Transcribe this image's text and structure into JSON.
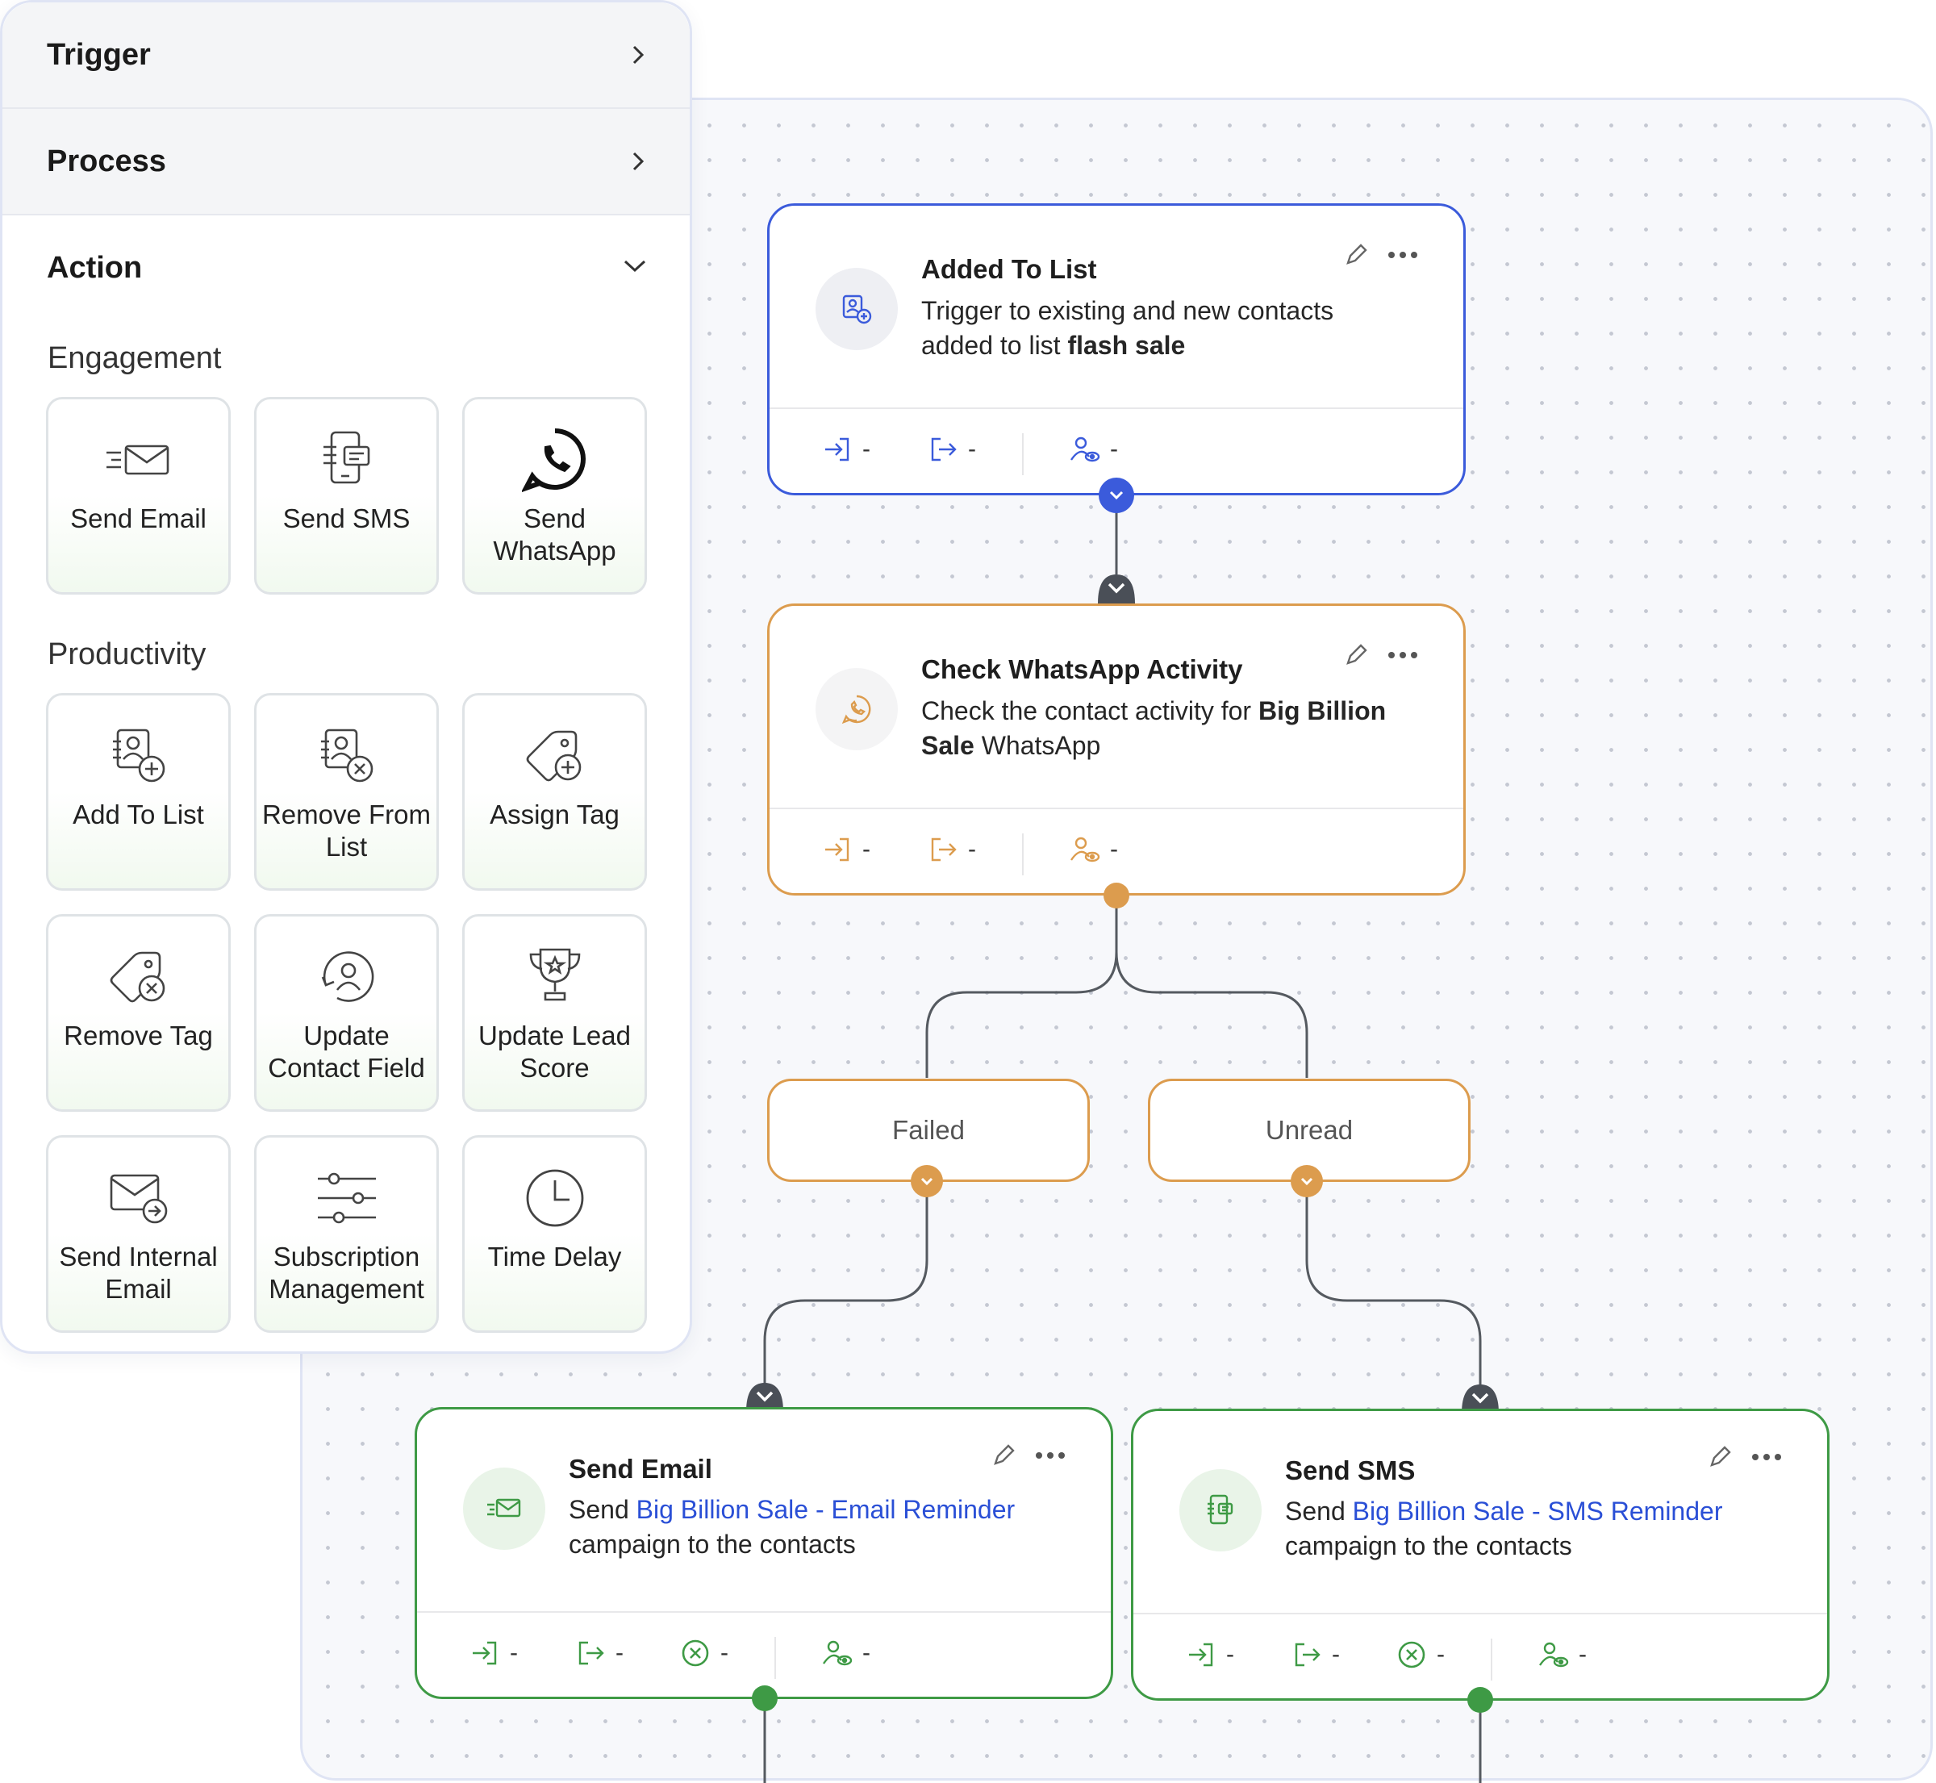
{
  "panel": {
    "sections": [
      {
        "label": "Trigger",
        "expanded": false
      },
      {
        "label": "Process",
        "expanded": false
      },
      {
        "label": "Action",
        "expanded": true
      }
    ],
    "groups": [
      {
        "label": "Engagement",
        "items": [
          {
            "label": "Send Email",
            "icon": "send-email-icon"
          },
          {
            "label": "Send SMS",
            "icon": "send-sms-icon"
          },
          {
            "label": "Send WhatsApp",
            "icon": "whatsapp-icon"
          }
        ]
      },
      {
        "label": "Productivity",
        "items": [
          {
            "label": "Add To List",
            "icon": "add-to-list-icon"
          },
          {
            "label": "Remove From List",
            "icon": "remove-from-list-icon"
          },
          {
            "label": "Assign Tag",
            "icon": "assign-tag-icon"
          },
          {
            "label": "Remove Tag",
            "icon": "remove-tag-icon"
          },
          {
            "label": "Update Contact Field",
            "icon": "update-contact-field-icon"
          },
          {
            "label": "Update Lead Score",
            "icon": "trophy-icon"
          },
          {
            "label": "Send Internal Email",
            "icon": "send-internal-email-icon"
          },
          {
            "label": "Subscription Management",
            "icon": "sliders-icon"
          },
          {
            "label": "Time Delay",
            "icon": "clock-icon"
          }
        ]
      }
    ]
  },
  "flow": {
    "trigger": {
      "title": "Added To List",
      "desc_text": "Trigger to existing and new contacts added to list ",
      "desc_bold": "flash sale",
      "stats": {
        "entered": "-",
        "exited": "-",
        "viewers": "-"
      }
    },
    "check": {
      "title": "Check WhatsApp Activity",
      "desc_prefix": "Check the contact activity for ",
      "desc_bold": "Big Billion Sale",
      "desc_suffix": " WhatsApp",
      "stats": {
        "entered": "-",
        "exited": "-",
        "viewers": "-"
      }
    },
    "branches": [
      {
        "label": "Failed"
      },
      {
        "label": "Unread"
      }
    ],
    "email": {
      "title": "Send Email",
      "desc_prefix": "Send ",
      "desc_link": "Big Billion Sale - Email Reminder",
      "desc_suffix": "campaign to the contacts",
      "stats": {
        "entered": "-",
        "exited": "-",
        "failed": "-",
        "viewers": "-"
      }
    },
    "sms": {
      "title": "Send SMS",
      "desc_prefix": "Send ",
      "desc_link": "Big Billion Sale - SMS Reminder",
      "desc_suffix": "campaign to the contacts",
      "stats": {
        "entered": "-",
        "exited": "-",
        "failed": "-",
        "viewers": "-"
      }
    }
  },
  "colors": {
    "trigger": "#3b5bdb",
    "condition": "#dc9c4e",
    "action": "#3e9a45",
    "link": "#2a4fd6"
  }
}
